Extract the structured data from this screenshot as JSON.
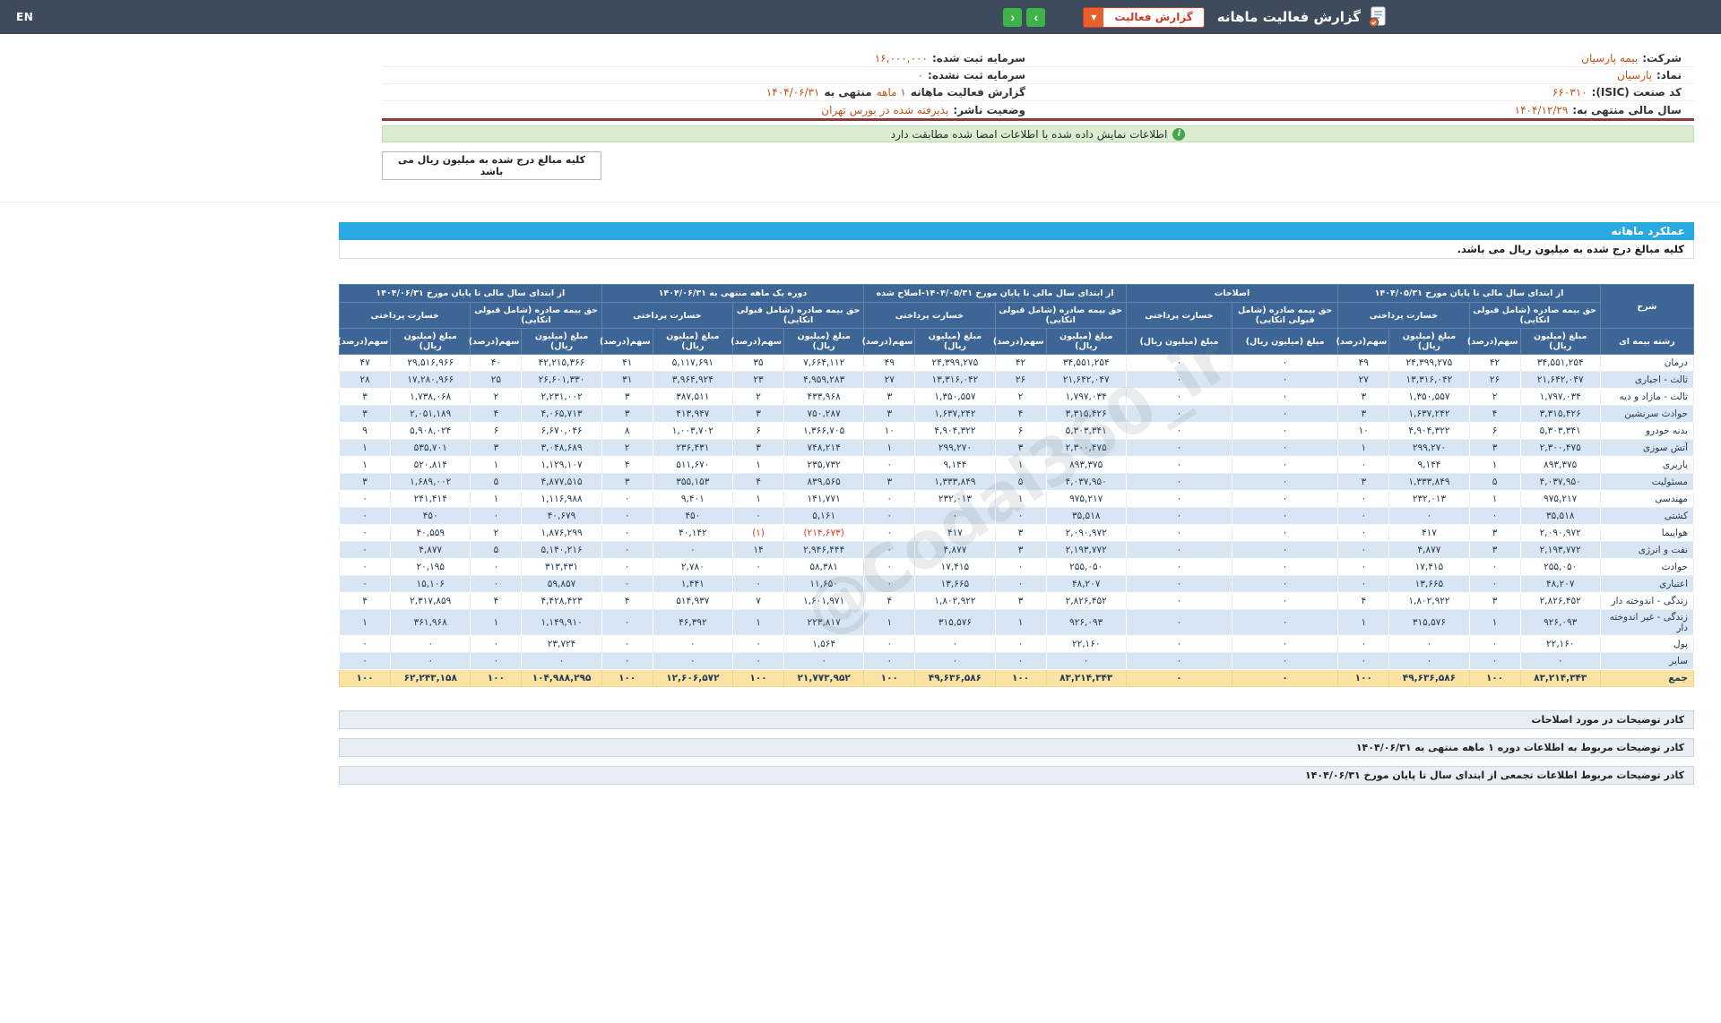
{
  "colors": {
    "topbar_bg": "#3d4b5c",
    "accent_green": "#3cb44a",
    "accent_red": "#cc3b2a",
    "accent_orange": "#e8602c",
    "section_blue": "#29a9e1",
    "table_head_bg": "#3d6595",
    "row_alt": "#d8e6f3",
    "total_bg": "#fbe3a3",
    "neg_red": "#e23527",
    "value_orange": "#c0541b",
    "maroon": "#8e3a3a",
    "notice_bg": "#d9eed0",
    "notice_green": "#44a648"
  },
  "topbar": {
    "title": "گزارش فعالیت ماهانه",
    "report_type_button": "گزارش فعالیت",
    "caret": "▼",
    "nav_right": "›",
    "nav_left": "‹",
    "lang": "EN"
  },
  "company": {
    "right": [
      {
        "label": "شرکت:",
        "value": "بیمه پارسیان"
      },
      {
        "label": "نماد:",
        "value": "پارسیان"
      },
      {
        "label": "کد صنعت (ISIC):",
        "value": "۶۶۰۳۱۰"
      },
      {
        "label": "سال مالی منتهی به:",
        "value": "۱۴۰۴/۱۲/۲۹"
      }
    ],
    "left": [
      {
        "label": "سرمایه ثبت شده:",
        "value": "۱۶,۰۰۰,۰۰۰"
      },
      {
        "label": "سرمایه ثبت نشده:",
        "value": "۰"
      },
      {
        "label": "گزارش فعالیت ماهانه",
        "value": "۱ ماهه",
        "mid": "منتهی به",
        "value2": "۱۴۰۴/۰۶/۳۱"
      },
      {
        "label": "وضعیت ناشر:",
        "value": "پذیرفته شده در بورس تهران"
      }
    ]
  },
  "notice": {
    "icon": "i",
    "text": "اطلاعات نمایش داده شده با اطلاعات امضا شده مطابقت دارد"
  },
  "unit_box": "کلیه مبالغ درج شده به میلیون ریال می باشد",
  "section": {
    "title": "عملکرد ماهانه",
    "unit_note": "کلیه مبالغ درج شده به میلیون ریال می باشد."
  },
  "watermark": "@Codal360_ir",
  "table": {
    "desc_header": "شرح",
    "row_header": "رشته بیمه ای",
    "premium_header": "حق بیمه صادره (شامل قبولی اتکایی)",
    "claims_header": "خسارت پرداختی",
    "amount_header": "مبلغ (میلیون ریال)",
    "share_header": "سهم(درصد)",
    "groups": [
      {
        "title": "از ابتدای سال مالی تا پایان مورخ ۱۴۰۴/۰۵/۳۱",
        "has_share": true
      },
      {
        "title": "اصلاحات",
        "has_share": false
      },
      {
        "title": "از ابتدای سال مالی تا پایان مورخ ۱۴۰۴/۰۵/۳۱-اصلاح شده",
        "has_share": true
      },
      {
        "title": "دوره یک ماهه منتهی به ۱۴۰۴/۰۶/۳۱",
        "has_share": true
      },
      {
        "title": "از ابتدای سال مالی تا پایان مورخ ۱۴۰۴/۰۶/۳۱",
        "has_share": true
      }
    ],
    "rows": [
      {
        "label": "درمان",
        "cells": [
          "۳۴,۵۵۱,۲۵۴",
          "۴۲",
          "۲۴,۳۹۹,۲۷۵",
          "۴۹",
          "۰",
          "۰",
          "۳۴,۵۵۱,۲۵۴",
          "۴۲",
          "۲۴,۳۹۹,۲۷۵",
          "۴۹",
          "۷,۶۶۴,۱۱۲",
          "۳۵",
          "۵,۱۱۷,۶۹۱",
          "۴۱",
          "۴۲,۲۱۵,۳۶۶",
          "۴۰",
          "۲۹,۵۱۶,۹۶۶",
          "۴۷"
        ]
      },
      {
        "label": "ثالث - اجباری",
        "cells": [
          "۲۱,۶۴۲,۰۴۷",
          "۲۶",
          "۱۳,۳۱۶,۰۴۲",
          "۲۷",
          "۰",
          "۰",
          "۲۱,۶۴۲,۰۴۷",
          "۲۶",
          "۱۳,۳۱۶,۰۴۲",
          "۲۷",
          "۴,۹۵۹,۲۸۳",
          "۲۳",
          "۳,۹۶۴,۹۲۴",
          "۳۱",
          "۲۶,۶۰۱,۳۳۰",
          "۲۵",
          "۱۷,۲۸۰,۹۶۶",
          "۲۸"
        ]
      },
      {
        "label": "ثالث - مازاد و دیه",
        "cells": [
          "۱,۷۹۷,۰۳۴",
          "۲",
          "۱,۳۵۰,۵۵۷",
          "۳",
          "۰",
          "۰",
          "۱,۷۹۷,۰۳۴",
          "۲",
          "۱,۳۵۰,۵۵۷",
          "۳",
          "۴۳۳,۹۶۸",
          "۲",
          "۳۸۷,۵۱۱",
          "۳",
          "۲,۲۳۱,۰۰۲",
          "۲",
          "۱,۷۳۸,۰۶۸",
          "۳"
        ]
      },
      {
        "label": "حوادث سرنشین",
        "cells": [
          "۳,۳۱۵,۴۲۶",
          "۴",
          "۱,۶۳۷,۲۴۲",
          "۳",
          "۰",
          "۰",
          "۳,۳۱۵,۴۲۶",
          "۴",
          "۱,۶۳۷,۲۴۲",
          "۳",
          "۷۵۰,۲۸۷",
          "۳",
          "۴۱۳,۹۴۷",
          "۳",
          "۴,۰۶۵,۷۱۳",
          "۴",
          "۲,۰۵۱,۱۸۹",
          "۳"
        ]
      },
      {
        "label": "بدنه خودرو",
        "cells": [
          "۵,۳۰۳,۳۴۱",
          "۶",
          "۴,۹۰۴,۳۲۲",
          "۱۰",
          "۰",
          "۰",
          "۵,۳۰۳,۳۴۱",
          "۶",
          "۴,۹۰۴,۳۲۲",
          "۱۰",
          "۱,۳۶۶,۷۰۵",
          "۶",
          "۱,۰۰۳,۷۰۲",
          "۸",
          "۶,۶۷۰,۰۴۶",
          "۶",
          "۵,۹۰۸,۰۲۴",
          "۹"
        ]
      },
      {
        "label": "آتش سوزی",
        "cells": [
          "۲,۳۰۰,۴۷۵",
          "۳",
          "۲۹۹,۲۷۰",
          "۱",
          "۰",
          "۰",
          "۲,۳۰۰,۴۷۵",
          "۳",
          "۲۹۹,۲۷۰",
          "۱",
          "۷۴۸,۲۱۴",
          "۳",
          "۲۳۶,۴۳۱",
          "۲",
          "۳,۰۴۸,۶۸۹",
          "۳",
          "۵۳۵,۷۰۱",
          "۱"
        ]
      },
      {
        "label": "باربری",
        "cells": [
          "۸۹۳,۳۷۵",
          "۱",
          "۹,۱۴۴",
          "۰",
          "۰",
          "۰",
          "۸۹۳,۳۷۵",
          "۱",
          "۹,۱۴۴",
          "۰",
          "۲۳۵,۷۳۲",
          "۱",
          "۵۱۱,۶۷۰",
          "۴",
          "۱,۱۲۹,۱۰۷",
          "۱",
          "۵۲۰,۸۱۴",
          "۱"
        ]
      },
      {
        "label": "مسئولیت",
        "cells": [
          "۴,۰۳۷,۹۵۰",
          "۵",
          "۱,۳۳۳,۸۴۹",
          "۳",
          "۰",
          "۰",
          "۴,۰۳۷,۹۵۰",
          "۵",
          "۱,۳۳۳,۸۴۹",
          "۳",
          "۸۳۹,۵۶۵",
          "۴",
          "۳۵۵,۱۵۳",
          "۳",
          "۴,۸۷۷,۵۱۵",
          "۵",
          "۱,۶۸۹,۰۰۲",
          "۳"
        ]
      },
      {
        "label": "مهندسی",
        "cells": [
          "۹۷۵,۲۱۷",
          "۱",
          "۲۳۲,۰۱۳",
          "۰",
          "۰",
          "۰",
          "۹۷۵,۲۱۷",
          "۱",
          "۲۳۲,۰۱۳",
          "۰",
          "۱۴۱,۷۷۱",
          "۱",
          "۹,۴۰۱",
          "۰",
          "۱,۱۱۶,۹۸۸",
          "۱",
          "۲۴۱,۴۱۴",
          "۰"
        ]
      },
      {
        "label": "کشتی",
        "cells": [
          "۳۵,۵۱۸",
          "۰",
          "۰",
          "۰",
          "۰",
          "۰",
          "۳۵,۵۱۸",
          "۰",
          "۰",
          "۰",
          "۵,۱۶۱",
          "۰",
          "۴۵۰",
          "۰",
          "۴۰,۶۷۹",
          "۰",
          "۴۵۰",
          "۰"
        ]
      },
      {
        "label": "هواپیما",
        "cells": [
          "۲,۰۹۰,۹۷۲",
          "۳",
          "۴۱۷",
          "۰",
          "۰",
          "۰",
          "۲,۰۹۰,۹۷۲",
          "۳",
          "۴۱۷",
          "۰",
          "(۲۱۴,۶۷۳)",
          "(۱)",
          "۴۰,۱۴۲",
          "۰",
          "۱,۸۷۶,۲۹۹",
          "۲",
          "۴۰,۵۵۹",
          "۰"
        ]
      },
      {
        "label": "نفت و انرژی",
        "cells": [
          "۲,۱۹۳,۷۷۲",
          "۳",
          "۴,۸۷۷",
          "۰",
          "۰",
          "۰",
          "۲,۱۹۳,۷۷۲",
          "۳",
          "۴,۸۷۷",
          "۰",
          "۲,۹۴۶,۴۴۴",
          "۱۴",
          "۰",
          "۰",
          "۵,۱۴۰,۲۱۶",
          "۵",
          "۴,۸۷۷",
          "۰"
        ]
      },
      {
        "label": "حوادث",
        "cells": [
          "۲۵۵,۰۵۰",
          "۰",
          "۱۷,۴۱۵",
          "۰",
          "۰",
          "۰",
          "۲۵۵,۰۵۰",
          "۰",
          "۱۷,۴۱۵",
          "۰",
          "۵۸,۳۸۱",
          "۰",
          "۲,۷۸۰",
          "۰",
          "۳۱۳,۴۳۱",
          "۰",
          "۲۰,۱۹۵",
          "۰"
        ]
      },
      {
        "label": "اعتباری",
        "cells": [
          "۴۸,۲۰۷",
          "۰",
          "۱۳,۶۶۵",
          "۰",
          "۰",
          "۰",
          "۴۸,۲۰۷",
          "۰",
          "۱۳,۶۶۵",
          "۰",
          "۱۱,۶۵۰",
          "۰",
          "۱,۴۴۱",
          "۰",
          "۵۹,۸۵۷",
          "۰",
          "۱۵,۱۰۶",
          "۰"
        ]
      },
      {
        "label": "زندگی - اندوخته دار",
        "cells": [
          "۲,۸۲۶,۴۵۲",
          "۳",
          "۱,۸۰۲,۹۲۲",
          "۴",
          "۰",
          "۰",
          "۲,۸۲۶,۴۵۲",
          "۳",
          "۱,۸۰۲,۹۲۲",
          "۴",
          "۱,۶۰۱,۹۷۱",
          "۷",
          "۵۱۴,۹۳۷",
          "۴",
          "۴,۴۲۸,۴۲۳",
          "۴",
          "۲,۳۱۷,۸۵۹",
          "۴"
        ]
      },
      {
        "label": "زندگی - غیر اندوخته دار",
        "cells": [
          "۹۲۶,۰۹۳",
          "۱",
          "۳۱۵,۵۷۶",
          "۱",
          "۰",
          "۰",
          "۹۲۶,۰۹۳",
          "۱",
          "۳۱۵,۵۷۶",
          "۱",
          "۲۲۳,۸۱۷",
          "۱",
          "۴۶,۳۹۲",
          "۰",
          "۱,۱۴۹,۹۱۰",
          "۱",
          "۳۶۱,۹۶۸",
          "۱"
        ]
      },
      {
        "label": "پول",
        "cells": [
          "۲۲,۱۶۰",
          "۰",
          "۰",
          "۰",
          "۰",
          "۰",
          "۲۲,۱۶۰",
          "۰",
          "۰",
          "۰",
          "۱,۵۶۴",
          "۰",
          "۰",
          "۰",
          "۲۳,۷۲۴",
          "۰",
          "۰",
          "۰"
        ]
      },
      {
        "label": "سایر",
        "cells": [
          "۰",
          "۰",
          "۰",
          "۰",
          "۰",
          "۰",
          "۰",
          "۰",
          "۰",
          "۰",
          "۰",
          "۰",
          "۰",
          "۰",
          "۰",
          "۰",
          "۰",
          "۰"
        ]
      }
    ],
    "total": {
      "label": "جمع",
      "cells": [
        "۸۳,۲۱۴,۳۴۳",
        "۱۰۰",
        "۴۹,۶۳۶,۵۸۶",
        "۱۰۰",
        "۰",
        "۰",
        "۸۳,۲۱۴,۳۴۳",
        "۱۰۰",
        "۴۹,۶۳۶,۵۸۶",
        "۱۰۰",
        "۲۱,۷۷۳,۹۵۲",
        "۱۰۰",
        "۱۲,۶۰۶,۵۷۲",
        "۱۰۰",
        "۱۰۴,۹۸۸,۲۹۵",
        "۱۰۰",
        "۶۲,۲۴۳,۱۵۸",
        "۱۰۰"
      ]
    }
  },
  "comment_boxes": [
    "کادر توضیحات در مورد اصلاحات",
    "کادر توضیحات مربوط به اطلاعات دوره ۱ ماهه منتهی به ۱۴۰۴/۰۶/۳۱",
    "کادر توضیحات مربوط اطلاعات تجمعی از ابتدای سال تا پایان مورخ ۱۴۰۴/۰۶/۳۱"
  ]
}
